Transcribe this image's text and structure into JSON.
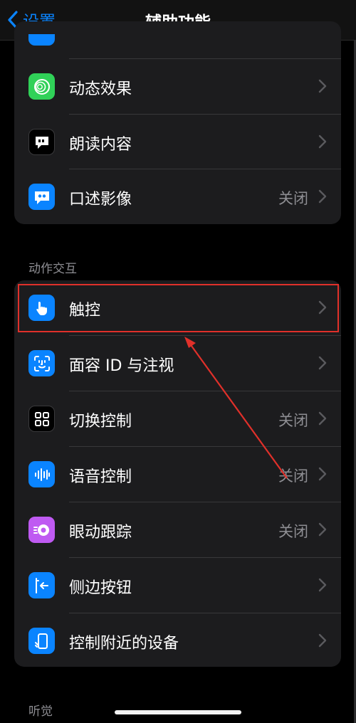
{
  "nav": {
    "back_label": "设置",
    "title": "辅助功能"
  },
  "group_vision": {
    "items": [
      {
        "label": "动态效果",
        "value": ""
      },
      {
        "label": "朗读内容",
        "value": ""
      },
      {
        "label": "口述影像",
        "value": "关闭"
      }
    ]
  },
  "group_interaction": {
    "header": "动作交互",
    "items": [
      {
        "label": "触控",
        "value": ""
      },
      {
        "label": "面容 ID 与注视",
        "value": ""
      },
      {
        "label": "切换控制",
        "value": "关闭"
      },
      {
        "label": "语音控制",
        "value": "关闭"
      },
      {
        "label": "眼动跟踪",
        "value": "关闭"
      },
      {
        "label": "侧边按钮",
        "value": ""
      },
      {
        "label": "控制附近的设备",
        "value": ""
      }
    ]
  },
  "group_hearing": {
    "header": "听觉"
  },
  "colors": {
    "accent": "#0a84ff",
    "highlight": "#e0302a",
    "green": "#30d158",
    "blue": "#0a84ff",
    "purple": "#bf5af2",
    "dark_icon": "#1c1c1e"
  },
  "icons": {
    "motion": "motion-circles-icon",
    "spoken": "speech-bubble-icon",
    "audio_desc": "quote-bubble-icon",
    "touch": "hand-point-icon",
    "faceid": "face-id-icon",
    "switch": "grid-squares-icon",
    "voice": "waveform-icon",
    "eye": "eye-tracking-icon",
    "side": "side-button-icon",
    "nearby": "nearby-device-icon"
  }
}
